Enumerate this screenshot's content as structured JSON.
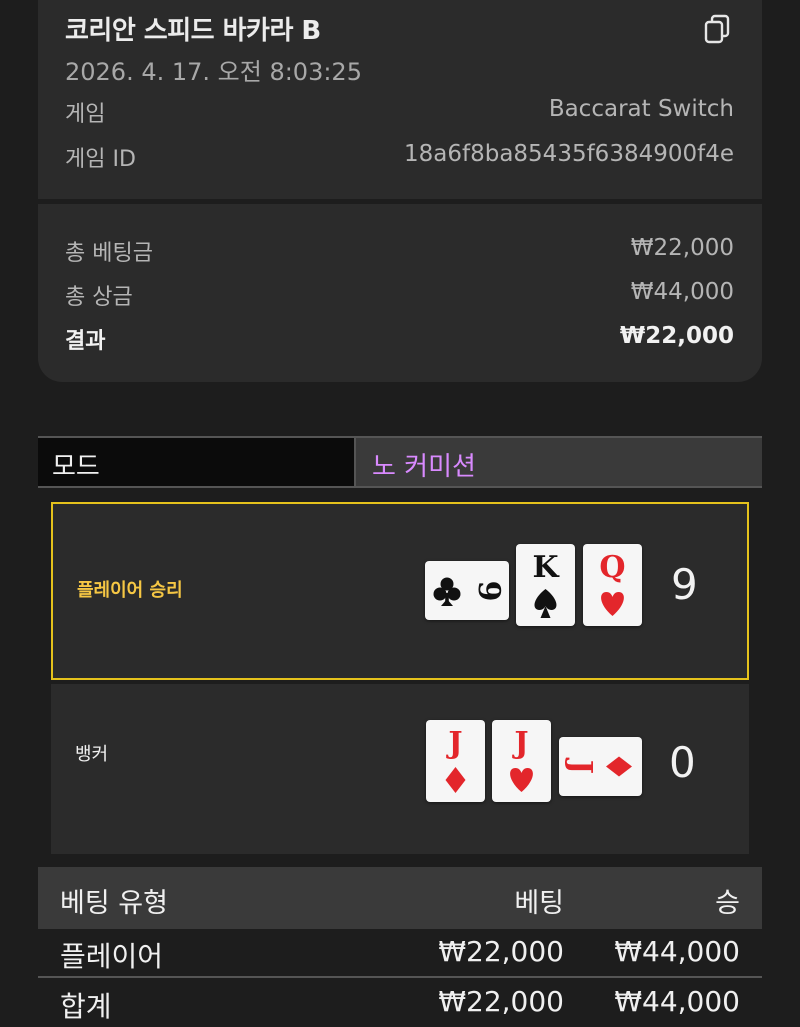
{
  "header": {
    "title": "코리안 스피드 바카라 B",
    "datetime": "2026. 4. 17. 오전 8:03:25",
    "game_label": "게임",
    "game_value": "Baccarat Switch",
    "game_id_label": "게임 ID",
    "game_id_value": "18a6f8ba85435f6384900f4e",
    "copy_icon": "copy-icon"
  },
  "summary": {
    "total_bet_label": "총 베팅금",
    "total_bet_value": "₩22,000",
    "total_win_label": "총 상금",
    "total_win_value": "₩44,000",
    "result_label": "결과",
    "result_value": "₩22,000"
  },
  "mode": {
    "label": "모드",
    "value": "노 커미션"
  },
  "hands": {
    "player": {
      "label": "플레이어 승리",
      "score": "9",
      "cards": [
        {
          "rank": "9",
          "suit": "clubs",
          "rotated": true
        },
        {
          "rank": "K",
          "suit": "spades",
          "rotated": false
        },
        {
          "rank": "Q",
          "suit": "hearts",
          "rotated": false
        }
      ]
    },
    "banker": {
      "label": "뱅커",
      "score": "0",
      "cards": [
        {
          "rank": "J",
          "suit": "diamonds",
          "rotated": false
        },
        {
          "rank": "J",
          "suit": "hearts",
          "rotated": false
        },
        {
          "rank": "J",
          "suit": "diamonds",
          "rotated": true
        }
      ]
    }
  },
  "bets_table": {
    "headers": [
      "베팅 유형",
      "베팅",
      "승"
    ],
    "rows": [
      {
        "type": "플레이어",
        "bet": "₩22,000",
        "win": "₩44,000"
      }
    ],
    "total": {
      "type": "합계",
      "bet": "₩22,000",
      "win": "₩44,000"
    }
  },
  "colors": {
    "player_win_accent": "#e5c21c",
    "mode_value": "#d98aff",
    "red_suit": "#e3262b",
    "black_suit": "#111111"
  }
}
